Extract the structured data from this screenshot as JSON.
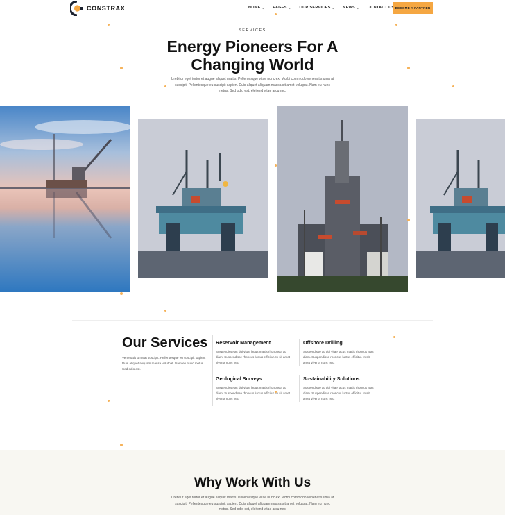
{
  "brand": {
    "name": "CONSTRAX"
  },
  "nav": {
    "items": [
      {
        "label": "HOME"
      },
      {
        "label": "PAGES"
      },
      {
        "label": "OUR SERVICES"
      },
      {
        "label": "NEWS"
      },
      {
        "label": "CONTACT US"
      }
    ],
    "cta_label": "BECOME A PARTNER"
  },
  "hero": {
    "eyebrow": "SERVICES",
    "title": "Energy Pioneers For A Changing World",
    "description": "Urebitur eget tortor et augue aliquet mattis. Pellentesque vitae nunc ex. Morbi commodo venenatis urna at suscipit. Pellentesque eu suscipit sapien. Duis aliquet aliquam massa sit amet volutpat. Nam eu nunc metus. Sed odio est, eleifend vitae arcu nec."
  },
  "services": {
    "title": "Our Services",
    "description": "Venenatis urna at suscipit. Pellentesque eu suscipit sapien. Duis aliquet aliquam massa volutpat. Nam eu nunc metus. Sed odio est.",
    "items": [
      {
        "title": "Reservoir Management",
        "text": "Suspendisse ac dui vitae lacus mattis rhoncus a ac diam. Suspendisse rhoncus luctus efficitur. In sit amet viverra nunc nec."
      },
      {
        "title": "Offshore Drilling",
        "text": "Suspendisse ac dui vitae lacus mattis rhoncus a ac diam. Suspendisse rhoncus luctus efficitur. In sit amet viverra nunc nec."
      },
      {
        "title": "Geological Surveys",
        "text": "Suspendisse ac dui vitae lacus mattis rhoncus a ac diam. Suspendisse rhoncus luctus efficitur. In sit amet viverra nunc nec."
      },
      {
        "title": "Sustainability Solutions",
        "text": "Suspendisse ac dui vitae lacus mattis rhoncus a ac diam. Suspendisse rhoncus luctus efficitur. In sit amet viverra nunc nec."
      }
    ]
  },
  "why": {
    "title": "Why Work With Us",
    "description": "Urebitur eget tortor et augue aliquet mattis. Pellentesque vitae nunc ex. Morbi commodo venenatis urna at suscipit. Pellentesque eu suscipit sapien. Duis aliquet aliquam massa sit amet volutpat. Nam eu nunc metus. Sed odio est, eleifend vitae arcu nec."
  },
  "colors": {
    "accent": "#f5a742",
    "dots": "#f5b25a",
    "band": "#f8f7f2"
  },
  "icons": [
    "logo-gear-icon",
    "chevron-down-icon"
  ]
}
